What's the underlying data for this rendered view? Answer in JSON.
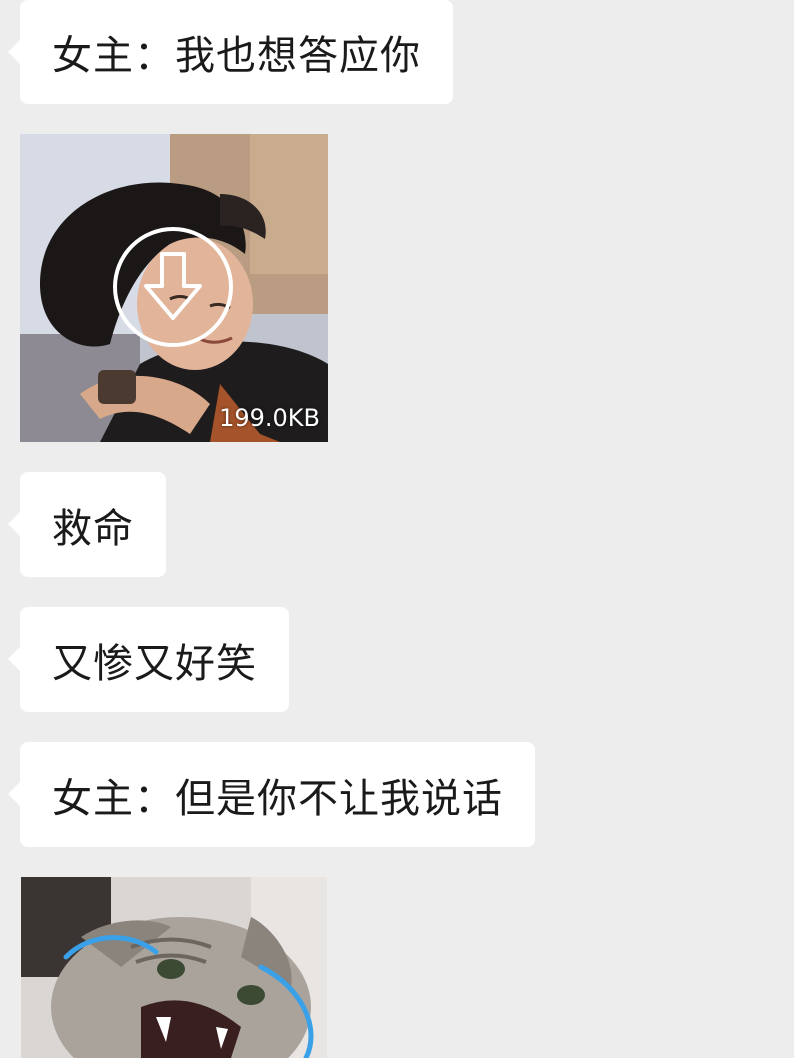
{
  "messages": [
    {
      "type": "text",
      "text": "女主：我也想答应你"
    },
    {
      "type": "image",
      "size": "199.0KB",
      "icon": "download-icon"
    },
    {
      "type": "text",
      "text": "救命"
    },
    {
      "type": "text",
      "text": "又惨又好笑"
    },
    {
      "type": "text",
      "text": "女主：但是你不让我说话"
    },
    {
      "type": "image",
      "content": "crying-cat-sticker"
    }
  ],
  "colors": {
    "background": "#ededed",
    "bubble": "#ffffff",
    "text": "#1a1a1a"
  }
}
